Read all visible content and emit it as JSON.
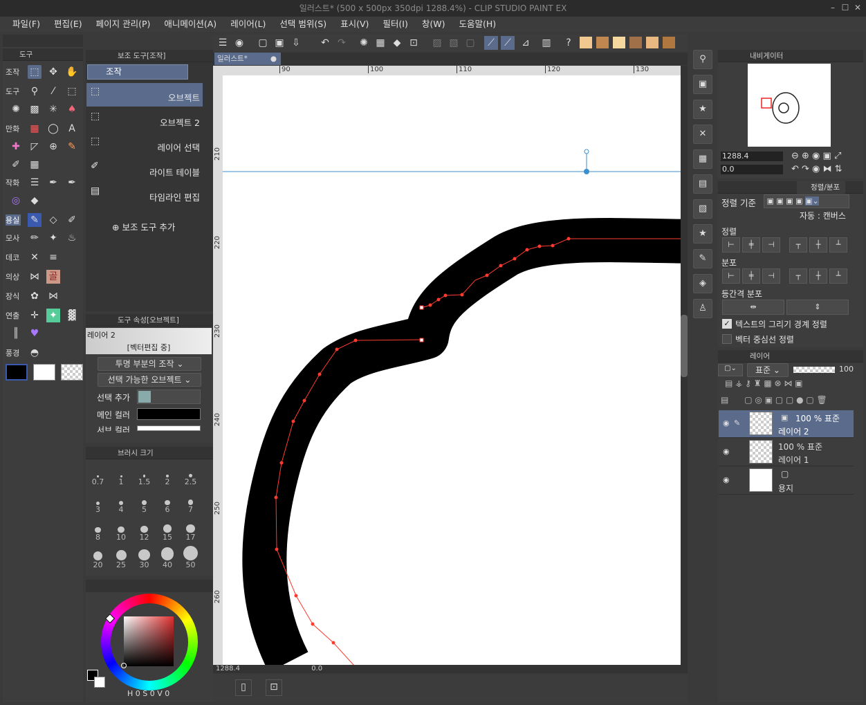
{
  "window": {
    "title": "일러스트* (500 x 500px 350dpi 1288.4%)  - CLIP STUDIO PAINT EX"
  },
  "menu": [
    "파일(F)",
    "편집(E)",
    "페이지 관리(P)",
    "애니메이션(A)",
    "레이어(L)",
    "선택 범위(S)",
    "표시(V)",
    "필터(I)",
    "창(W)",
    "도움말(H)"
  ],
  "tool_panel": {
    "title": "도구",
    "groups": [
      "조작",
      "도구",
      "만화",
      "작화",
      "용실",
      "모사",
      "데코",
      "의상",
      "장식",
      "연출",
      "풍경"
    ]
  },
  "subtool_panel": {
    "title": "보조 도구[조작]",
    "group": "조작",
    "items": [
      "오브젝트",
      "오브젝트 2",
      "레이어 선택",
      "라이트 테이블",
      "타임라인 편집"
    ],
    "add_label": "보조 도구 추가"
  },
  "tool_property": {
    "title": "도구 속성[오브젝트]",
    "layer_name": "레이어 2",
    "edit_status": "[벡터편집 중]",
    "transparent_op": "투명 부분의 조작",
    "selectable_obj": "선택 가능한 오브젝트",
    "select_add_label": "선택 추가",
    "main_color_label": "메인 컬러",
    "sub_color_label": "서브 컬러"
  },
  "brush_size": {
    "title": "브러시 크기",
    "sizes": [
      "0.7",
      "1",
      "1.5",
      "2",
      "2.5",
      "3",
      "4",
      "5",
      "6",
      "7",
      "8",
      "10",
      "12",
      "15",
      "17",
      "20",
      "25",
      "30",
      "40",
      "50"
    ]
  },
  "color": {
    "values": [
      "0",
      "0",
      "0"
    ]
  },
  "canvas": {
    "tab": "일러스트*",
    "ruler_h": [
      "90",
      "100",
      "110",
      "120",
      "130"
    ],
    "ruler_v": [
      "210",
      "220",
      "230",
      "240",
      "250",
      "260"
    ],
    "zoom": "1288.4",
    "rotate": "0.0"
  },
  "navigator": {
    "title": "내비게이터",
    "zoom": "1288.4",
    "rotate": "0.0"
  },
  "align_panel": {
    "tab": "정렬/분포",
    "basis_label": "정렬 기준",
    "auto_label": "자동 : 캔버스",
    "align_label": "정렬",
    "distribute_label": "분포",
    "equal_label": "등간격 분포",
    "check1": "텍스트의 그리기 경계 정렬",
    "check2": "벡터 중심선 정렬"
  },
  "layer_panel": {
    "title": "레이어",
    "blend": "표준",
    "opacity": "100",
    "layers": [
      {
        "mode": "100 % 표준",
        "name": "레이어 2"
      },
      {
        "mode": "100 % 표준",
        "name": "레이어 1"
      },
      {
        "mode": "",
        "name": "용지"
      }
    ]
  },
  "colors": {
    "accent": "#5a6b8c",
    "path": "#ff3b2f",
    "guide": "#3a8fd0"
  }
}
